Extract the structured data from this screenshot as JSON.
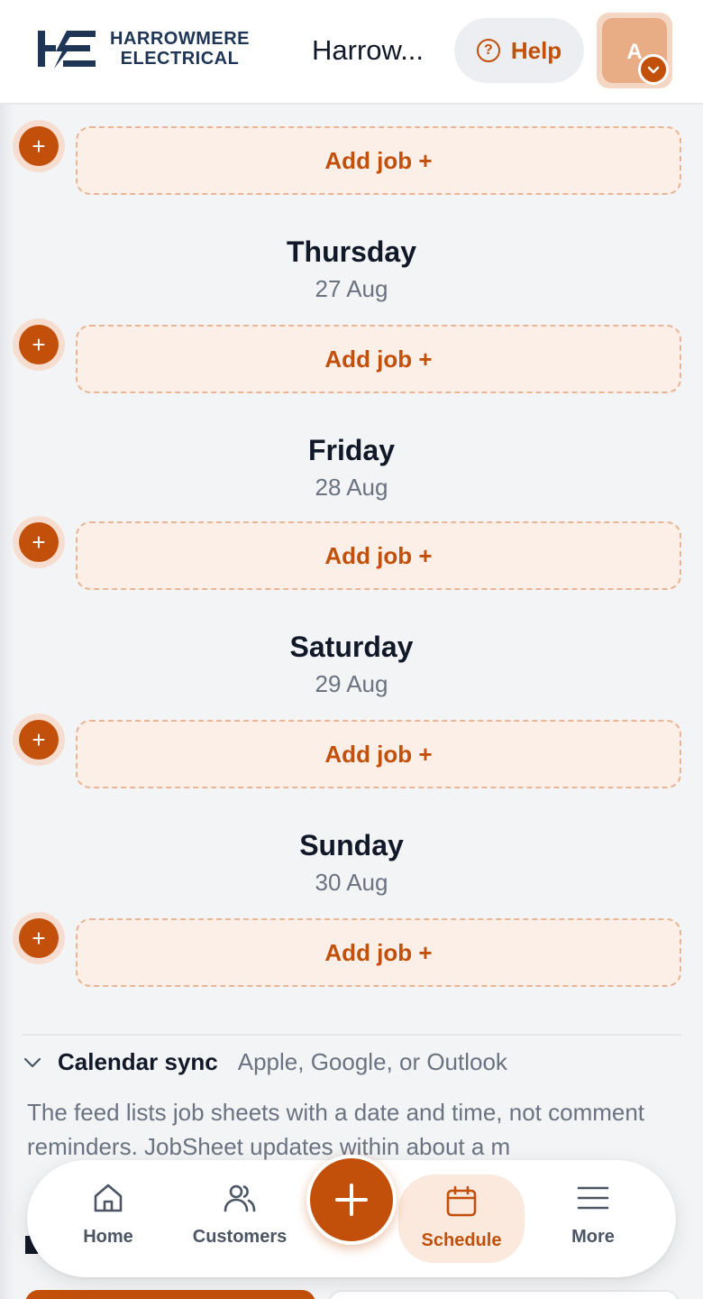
{
  "header": {
    "logo_line1": "HARROWMERE",
    "logo_line2": "ELECTRICAL",
    "company_name": "Harrow...",
    "help_label": "Help",
    "avatar_initial": "A"
  },
  "schedule": {
    "add_job_label": "Add job +",
    "days": [
      {
        "name": "Thursday",
        "date": "27 Aug"
      },
      {
        "name": "Friday",
        "date": "28 Aug"
      },
      {
        "name": "Saturday",
        "date": "29 Aug"
      },
      {
        "name": "Sunday",
        "date": "30 Aug"
      }
    ]
  },
  "calendar_sync": {
    "title": "Calendar sync",
    "subtitle": "Apple, Google, or Outlook",
    "description": "The feed lists job sheets with a date and time, not comment reminders. JobSheet updates within about a m"
  },
  "nav": {
    "home": "Home",
    "customers": "Customers",
    "schedule": "Schedule",
    "more": "More",
    "active": "schedule"
  },
  "colors": {
    "accent": "#c2500b",
    "accent_soft": "#fbefe7",
    "brand_navy": "#1e3556"
  }
}
